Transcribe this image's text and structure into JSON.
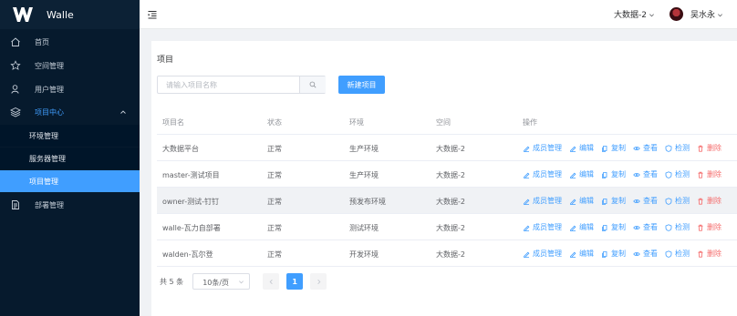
{
  "app": {
    "title": "Walle"
  },
  "sidebar": {
    "items": [
      {
        "label": "首页",
        "icon": "home-icon"
      },
      {
        "label": "空间管理",
        "icon": "star-icon"
      },
      {
        "label": "用户管理",
        "icon": "user-icon"
      },
      {
        "label": "项目中心",
        "icon": "layers-icon",
        "expanded": true,
        "children": [
          {
            "label": "环境管理"
          },
          {
            "label": "服务器管理"
          },
          {
            "label": "项目管理",
            "active": true
          }
        ]
      },
      {
        "label": "部署管理",
        "icon": "document-icon"
      }
    ]
  },
  "header": {
    "space": "大数据-2",
    "user": "吴水永"
  },
  "page": {
    "title": "项目",
    "search_placeholder": "请输入项目名称",
    "new_button": "新建项目"
  },
  "table": {
    "columns": [
      "项目名",
      "状态",
      "环境",
      "空间",
      "操作"
    ],
    "rows": [
      {
        "name": "大数据平台",
        "status": "正常",
        "env": "生产环境",
        "space": "大数据-2"
      },
      {
        "name": "master-测试项目",
        "status": "正常",
        "env": "生产环境",
        "space": "大数据-2"
      },
      {
        "name": "owner-测试-钉钉",
        "status": "正常",
        "env": "预发布环境",
        "space": "大数据-2"
      },
      {
        "name": "walle-瓦力自部署",
        "status": "正常",
        "env": "测试环境",
        "space": "大数据-2"
      },
      {
        "name": "walden-瓦尔登",
        "status": "正常",
        "env": "开发环境",
        "space": "大数据-2"
      }
    ],
    "actions": [
      "成员管理",
      "编辑",
      "复制",
      "查看",
      "检测",
      "删除"
    ]
  },
  "pagination": {
    "total": "共 5 条",
    "page_size": "10条/页",
    "current": "1"
  },
  "colors": {
    "primary": "#409eff",
    "danger": "#f56c6c",
    "sidebar": "#061a2d"
  }
}
